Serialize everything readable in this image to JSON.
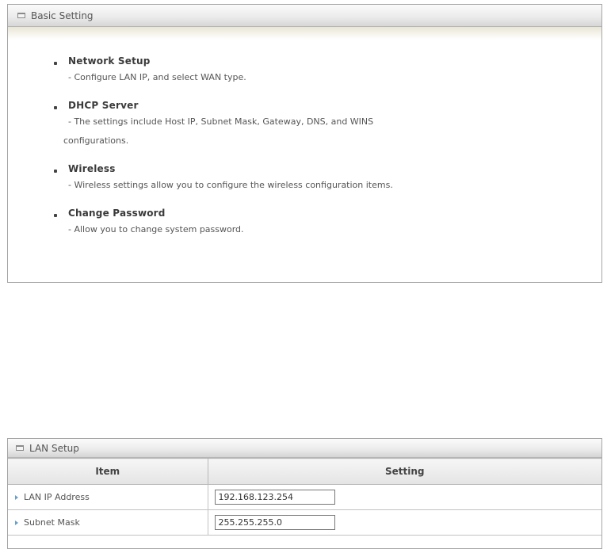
{
  "basic_setting": {
    "title": "Basic Setting",
    "items": [
      {
        "title": "Network Setup",
        "desc": "- Configure LAN IP, and select WAN type."
      },
      {
        "title": "DHCP Server",
        "desc": "- The settings include Host IP, Subnet Mask, Gateway, DNS, and WINS",
        "desc_cont": "configurations."
      },
      {
        "title": "Wireless",
        "desc": "- Wireless settings allow you to configure the wireless configuration items."
      },
      {
        "title": "Change Password",
        "desc": "- Allow you to change system password."
      }
    ]
  },
  "lan_setup": {
    "title": "LAN Setup",
    "columns": [
      "Item",
      "Setting"
    ],
    "rows": [
      {
        "label": "LAN IP Address",
        "value": "192.168.123.254"
      },
      {
        "label": "Subnet Mask",
        "value": "255.255.255.0"
      }
    ]
  }
}
